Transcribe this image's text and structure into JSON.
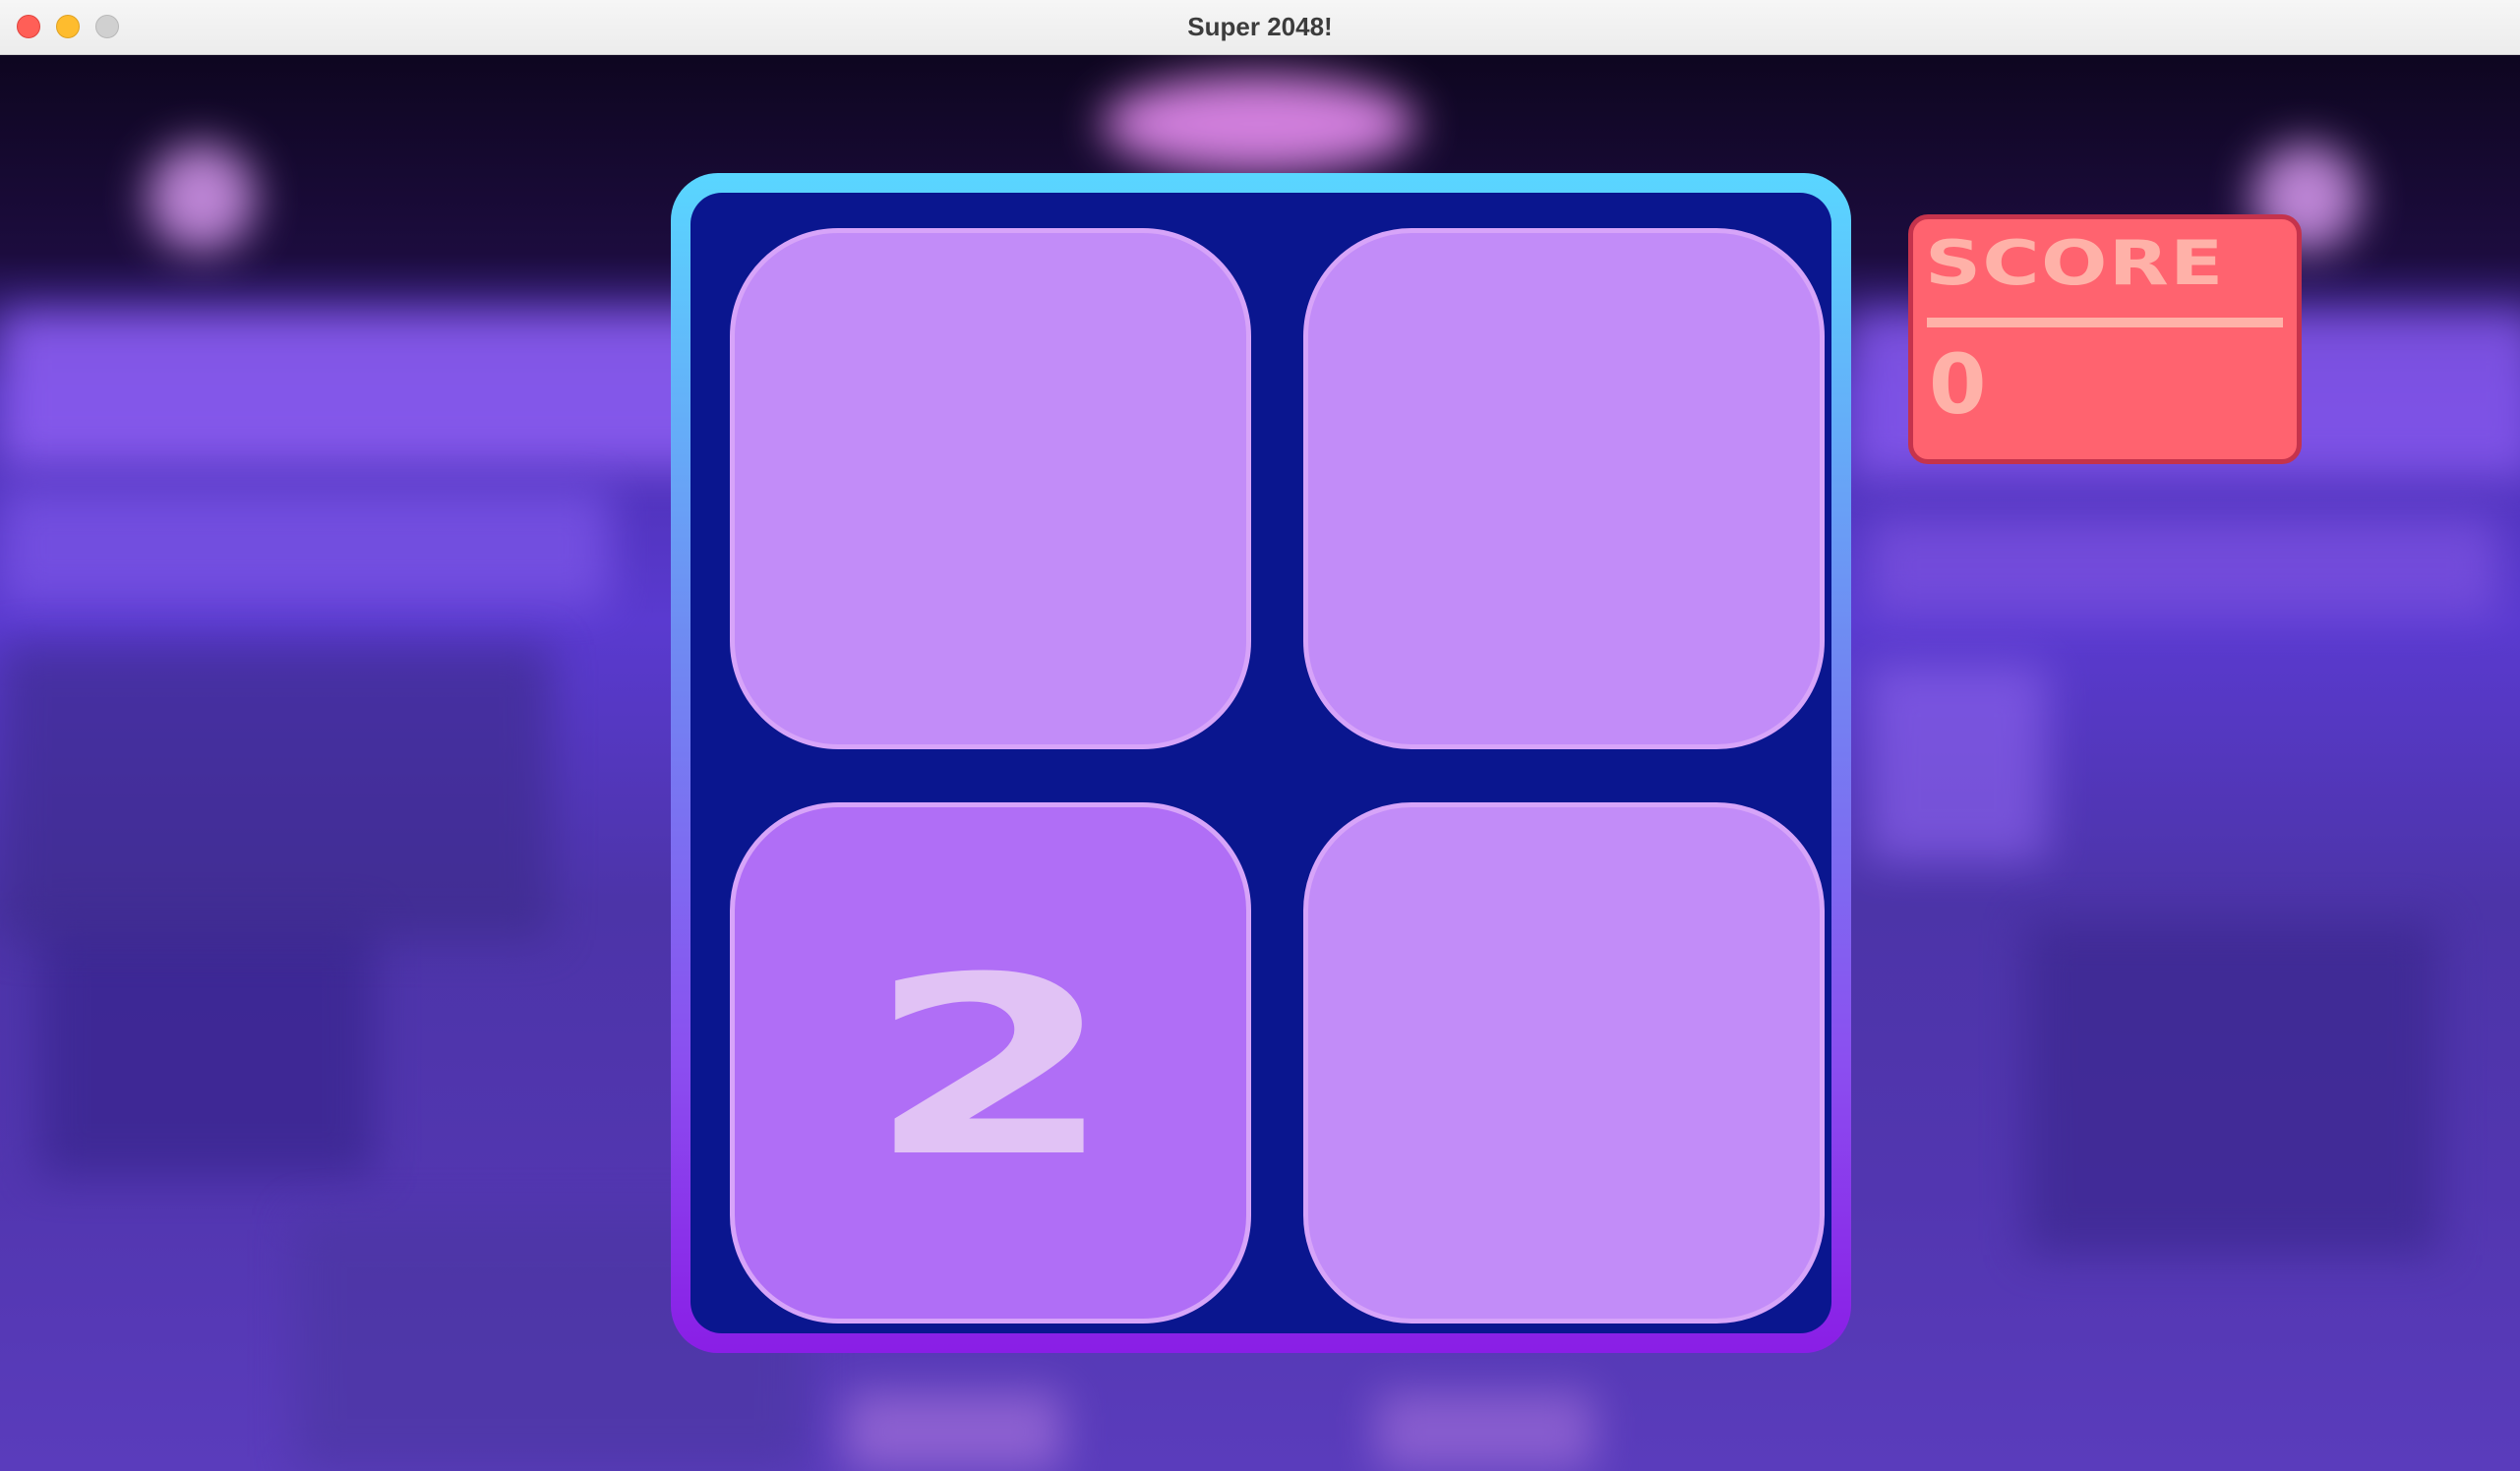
{
  "window": {
    "title": "Super 2048!"
  },
  "board": {
    "size": 2,
    "tiles": [
      {
        "value": ""
      },
      {
        "value": ""
      },
      {
        "value": "2"
      },
      {
        "value": ""
      }
    ],
    "colors": {
      "frame_top": "#59d6ff",
      "frame_bottom": "#8a1ee6",
      "board_bg": "#0a168f",
      "empty_tile": "#c28cf8",
      "tile_2": "#b06ef6",
      "tile_text": "#e1c2f5"
    }
  },
  "score": {
    "label": "SCORE",
    "value": "0",
    "colors": {
      "panel_bg": "#ff636f",
      "panel_border": "#c5334c",
      "text": "#ffb1a8"
    }
  }
}
